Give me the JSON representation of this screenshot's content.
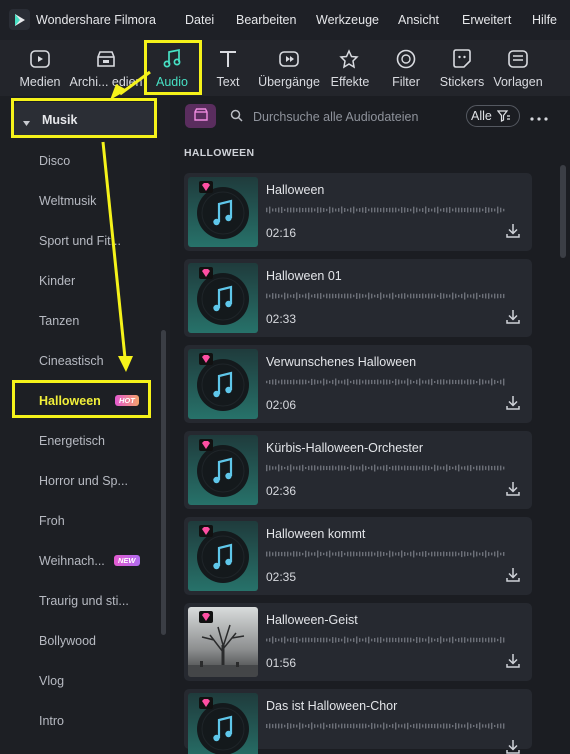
{
  "app": {
    "title": "Wondershare Filmora"
  },
  "menu": [
    "Datei",
    "Bearbeiten",
    "Werkzeuge",
    "Ansicht",
    "Erweitert",
    "Hilfe"
  ],
  "toolbar": {
    "tabs": [
      {
        "label": "Medien",
        "icon": "media-icon"
      },
      {
        "label": "Archi... edien",
        "icon": "archive-icon"
      },
      {
        "label": "Audio",
        "icon": "music-note-icon",
        "active": true
      },
      {
        "label": "Text",
        "icon": "text-icon"
      },
      {
        "label": "Übergänge",
        "icon": "transition-icon"
      },
      {
        "label": "Effekte",
        "icon": "effects-icon"
      },
      {
        "label": "Filter",
        "icon": "filter-icon"
      },
      {
        "label": "Stickers",
        "icon": "sticker-icon"
      },
      {
        "label": "Vorlagen",
        "icon": "template-icon"
      }
    ]
  },
  "sidebar": {
    "group": "Musik",
    "items": [
      {
        "label": "Disco"
      },
      {
        "label": "Weltmusik"
      },
      {
        "label": "Sport und Fit..."
      },
      {
        "label": "Kinder"
      },
      {
        "label": "Tanzen"
      },
      {
        "label": "Cineastisch"
      },
      {
        "label": "Halloween",
        "badge": "HOT",
        "selected": true
      },
      {
        "label": "Energetisch"
      },
      {
        "label": "Horror und Sp..."
      },
      {
        "label": "Froh"
      },
      {
        "label": "Weihnach...",
        "badge": "NEW"
      },
      {
        "label": "Traurig und sti..."
      },
      {
        "label": "Bollywood"
      },
      {
        "label": "Vlog"
      },
      {
        "label": "Intro"
      }
    ]
  },
  "search": {
    "placeholder": "Durchsuche alle Audiodateien"
  },
  "filter": {
    "label": "Alle"
  },
  "section": {
    "title": "HALLOWEEN"
  },
  "tracks": [
    {
      "title": "Halloween",
      "duration": "02:16"
    },
    {
      "title": "Halloween 01",
      "duration": "02:33"
    },
    {
      "title": "Verwunschenes Halloween",
      "duration": "02:06"
    },
    {
      "title": "Kürbis-Halloween-Orchester",
      "duration": "02:36"
    },
    {
      "title": "Halloween kommt",
      "duration": "02:35"
    },
    {
      "title": "Halloween-Geist",
      "duration": "01:56",
      "thumb": "photo"
    },
    {
      "title": "Das ist Halloween-Chor",
      "duration": ""
    }
  ],
  "colors": {
    "accent": "#47e0c4",
    "highlight": "#f5f21a",
    "selected_text": "#f1ef3a",
    "hot_badge": "#e45bd0",
    "gem": "#ff4fa3"
  }
}
